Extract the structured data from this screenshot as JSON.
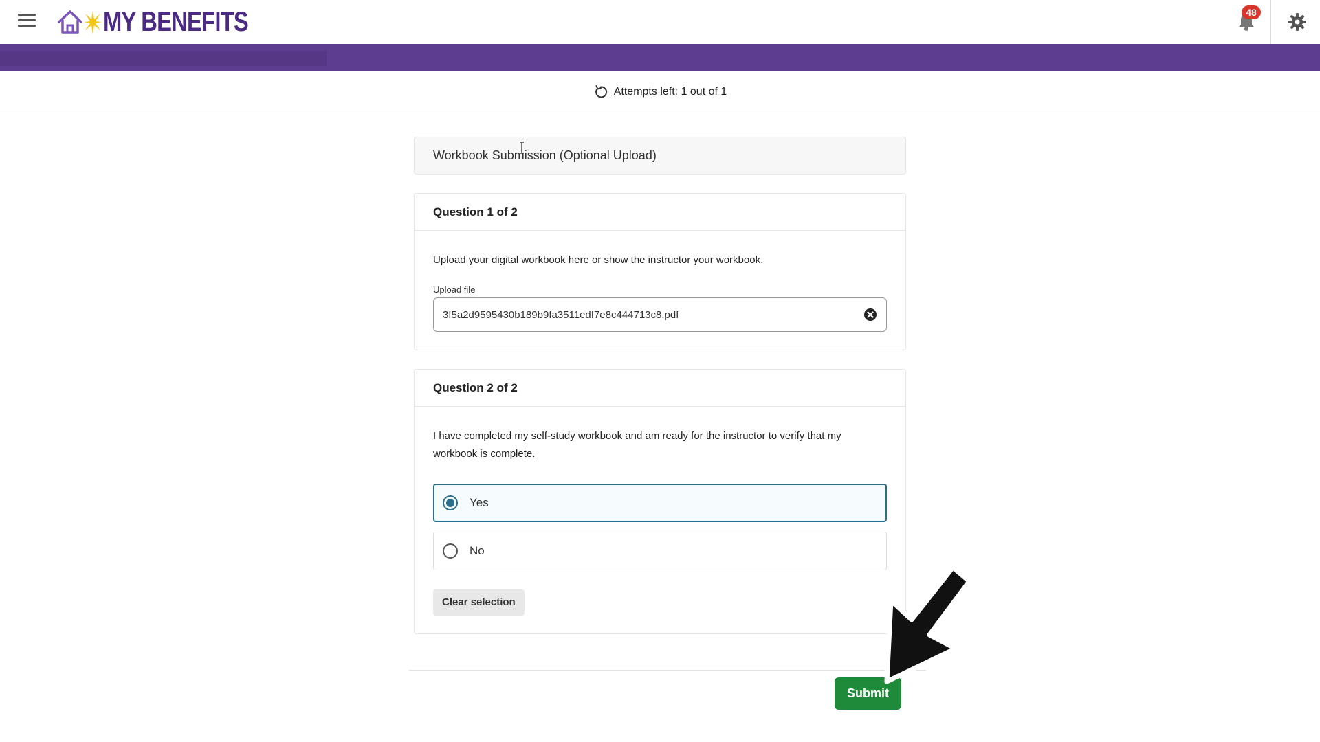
{
  "header": {
    "brand": "MY BENEFITS",
    "notification_count": "48"
  },
  "attempts": {
    "text": "Attempts left: 1 out of 1"
  },
  "section": {
    "title": "Workbook Submission (Optional Upload)"
  },
  "questions": [
    {
      "heading": "Question 1 of 2",
      "prompt": "Upload your digital workbook here or show the instructor your workbook.",
      "field_label": "Upload file",
      "file_value": "3f5a2d9595430b189b9fa3511edf7e8c444713c8.pdf"
    },
    {
      "heading": "Question 2 of 2",
      "prompt": "I have completed my self-study workbook and am ready for the instructor to verify that my workbook is complete.",
      "options": [
        {
          "label": "Yes",
          "selected": true
        },
        {
          "label": "No",
          "selected": false
        }
      ],
      "clear_label": "Clear selection"
    }
  ],
  "actions": {
    "submit_label": "Submit"
  },
  "colors": {
    "brand_purple": "#4a2a82",
    "band_purple": "#5d3d8f",
    "badge_red": "#d9352a",
    "selected_teal": "#2a6e8c",
    "submit_green": "#1f8a3a"
  },
  "icons": {
    "menu": "hamburger-menu-icon",
    "home": "home-icon",
    "notifications": "bell-icon",
    "settings": "gear-icon",
    "attempts": "retry-icon",
    "clear_file": "close-circle-icon"
  }
}
